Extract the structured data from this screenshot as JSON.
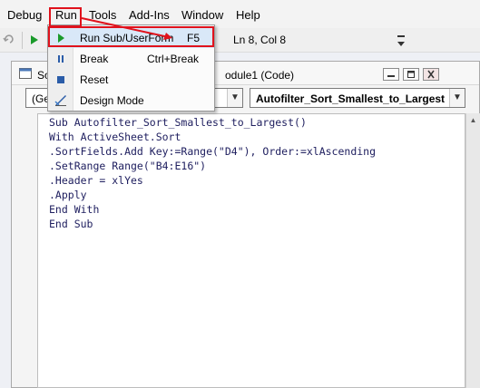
{
  "menubar": {
    "items": [
      "Debug",
      "Run",
      "Tools",
      "Add-Ins",
      "Window",
      "Help"
    ]
  },
  "toolbar": {
    "status": "Ln 8, Col 8"
  },
  "run_menu": {
    "items": [
      {
        "label": "Run Sub/UserForm",
        "shortcut": "F5",
        "icon": "play-icon"
      },
      {
        "label": "Break",
        "shortcut": "Ctrl+Break",
        "icon": "pause-icon"
      },
      {
        "label": "Reset",
        "shortcut": "",
        "icon": "stop-icon"
      },
      {
        "label": "Design Mode",
        "shortcut": "",
        "icon": "design-mode-icon"
      }
    ]
  },
  "code_window": {
    "title_left": "So",
    "title_right": "odule1 (Code)",
    "object_combo": "(Ger",
    "procedure_combo": "Autofilter_Sort_Smallest_to_Largest",
    "lines": [
      "Sub Autofilter_Sort_Smallest_to_Largest()",
      "With ActiveSheet.Sort",
      ".SortFields.Add Key:=Range(\"D4\"), Order:=xlAscending",
      ".SetRange Range(\"B4:E16\")",
      ".Header = xlYes",
      ".Apply",
      "End With",
      "End Sub"
    ]
  },
  "colors": {
    "highlight_red": "#e0121c",
    "selected_item": "#d9e8f8",
    "play_green": "#1a9a2a"
  }
}
